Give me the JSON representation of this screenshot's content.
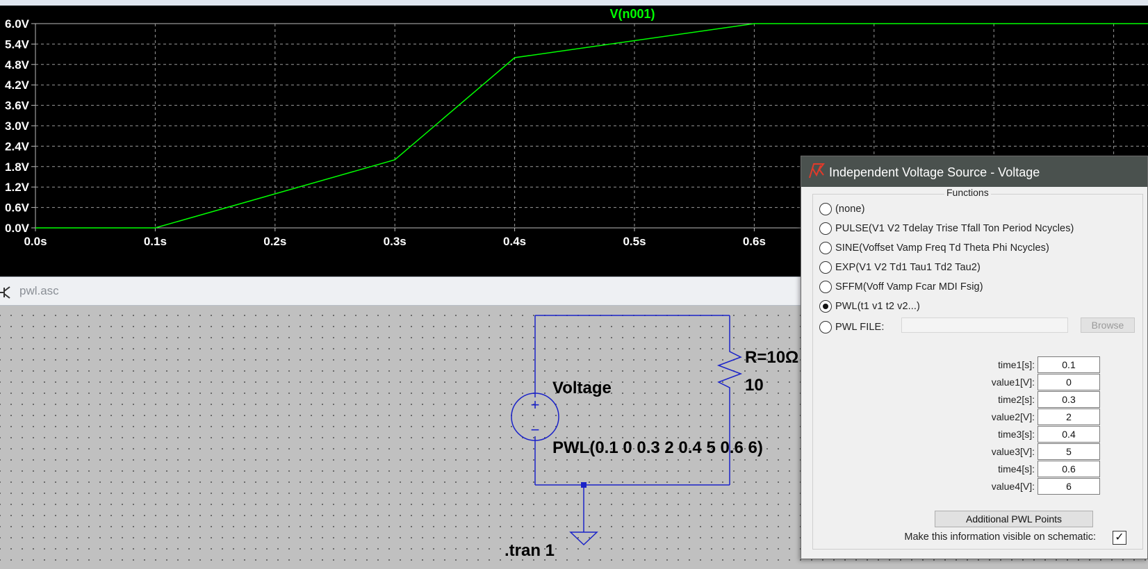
{
  "plot": {
    "trace_name": "V(n001)",
    "trace_color": "#00ff00",
    "grid_color": "#9a9a9a",
    "y_ticks": [
      "6.0V",
      "5.4V",
      "4.8V",
      "4.2V",
      "3.6V",
      "3.0V",
      "2.4V",
      "1.8V",
      "1.2V",
      "0.6V",
      "0.0V"
    ],
    "x_ticks": [
      "0.0s",
      "0.1s",
      "0.2s",
      "0.3s",
      "0.4s",
      "0.5s",
      "0.6s"
    ]
  },
  "chart_data": {
    "type": "line",
    "title": "V(n001)",
    "xlabel": "",
    "ylabel": "",
    "xlim": [
      0,
      1
    ],
    "ylim": [
      0,
      6
    ],
    "grid": true,
    "series": [
      {
        "name": "V(n001)",
        "x": [
          0,
          0.1,
          0.3,
          0.4,
          0.6,
          1.0
        ],
        "y": [
          0,
          0,
          2,
          5,
          6,
          6
        ]
      }
    ]
  },
  "schematic_window": {
    "title": "pwl.asc"
  },
  "schematic": {
    "wire_color": "#1a22c8",
    "source_name": "Voltage",
    "source_value": "PWL(0.1 0 0.3 2 0.4 5 0.6 6)",
    "resistor_name": "R=10Ω",
    "resistor_value": "10",
    "directive": ".tran 1",
    "plus_symbol": "+",
    "minus_symbol": "−"
  },
  "dialog": {
    "title": "Independent Voltage Source - Voltage",
    "icon": "ltspice-logo-icon",
    "functions_legend": "Functions",
    "functions": [
      {
        "label": "(none)",
        "checked": false
      },
      {
        "label": "PULSE(V1 V2 Tdelay Trise Tfall Ton Period Ncycles)",
        "checked": false
      },
      {
        "label": "SINE(Voffset Vamp Freq Td Theta Phi Ncycles)",
        "checked": false
      },
      {
        "label": "EXP(V1 V2 Td1 Tau1 Td2 Tau2)",
        "checked": false
      },
      {
        "label": "SFFM(Voff Vamp Fcar MDI Fsig)",
        "checked": false
      },
      {
        "label": "PWL(t1 v1 t2 v2...)",
        "checked": true
      },
      {
        "label": "PWL FILE:",
        "checked": false
      }
    ],
    "pwl_file_value": "",
    "browse_label": "Browse",
    "params": [
      {
        "label": "time1[s]:",
        "value": "0.1"
      },
      {
        "label": "value1[V]:",
        "value": "0"
      },
      {
        "label": "time2[s]:",
        "value": "0.3"
      },
      {
        "label": "value2[V]:",
        "value": "2"
      },
      {
        "label": "time3[s]:",
        "value": "0.4"
      },
      {
        "label": "value3[V]:",
        "value": "5"
      },
      {
        "label": "time4[s]:",
        "value": "0.6"
      },
      {
        "label": "value4[V]:",
        "value": "6"
      }
    ],
    "additional_button": "Additional PWL Points",
    "visible_label": "Make this information visible on schematic:",
    "visible_checked_glyph": "✓"
  }
}
